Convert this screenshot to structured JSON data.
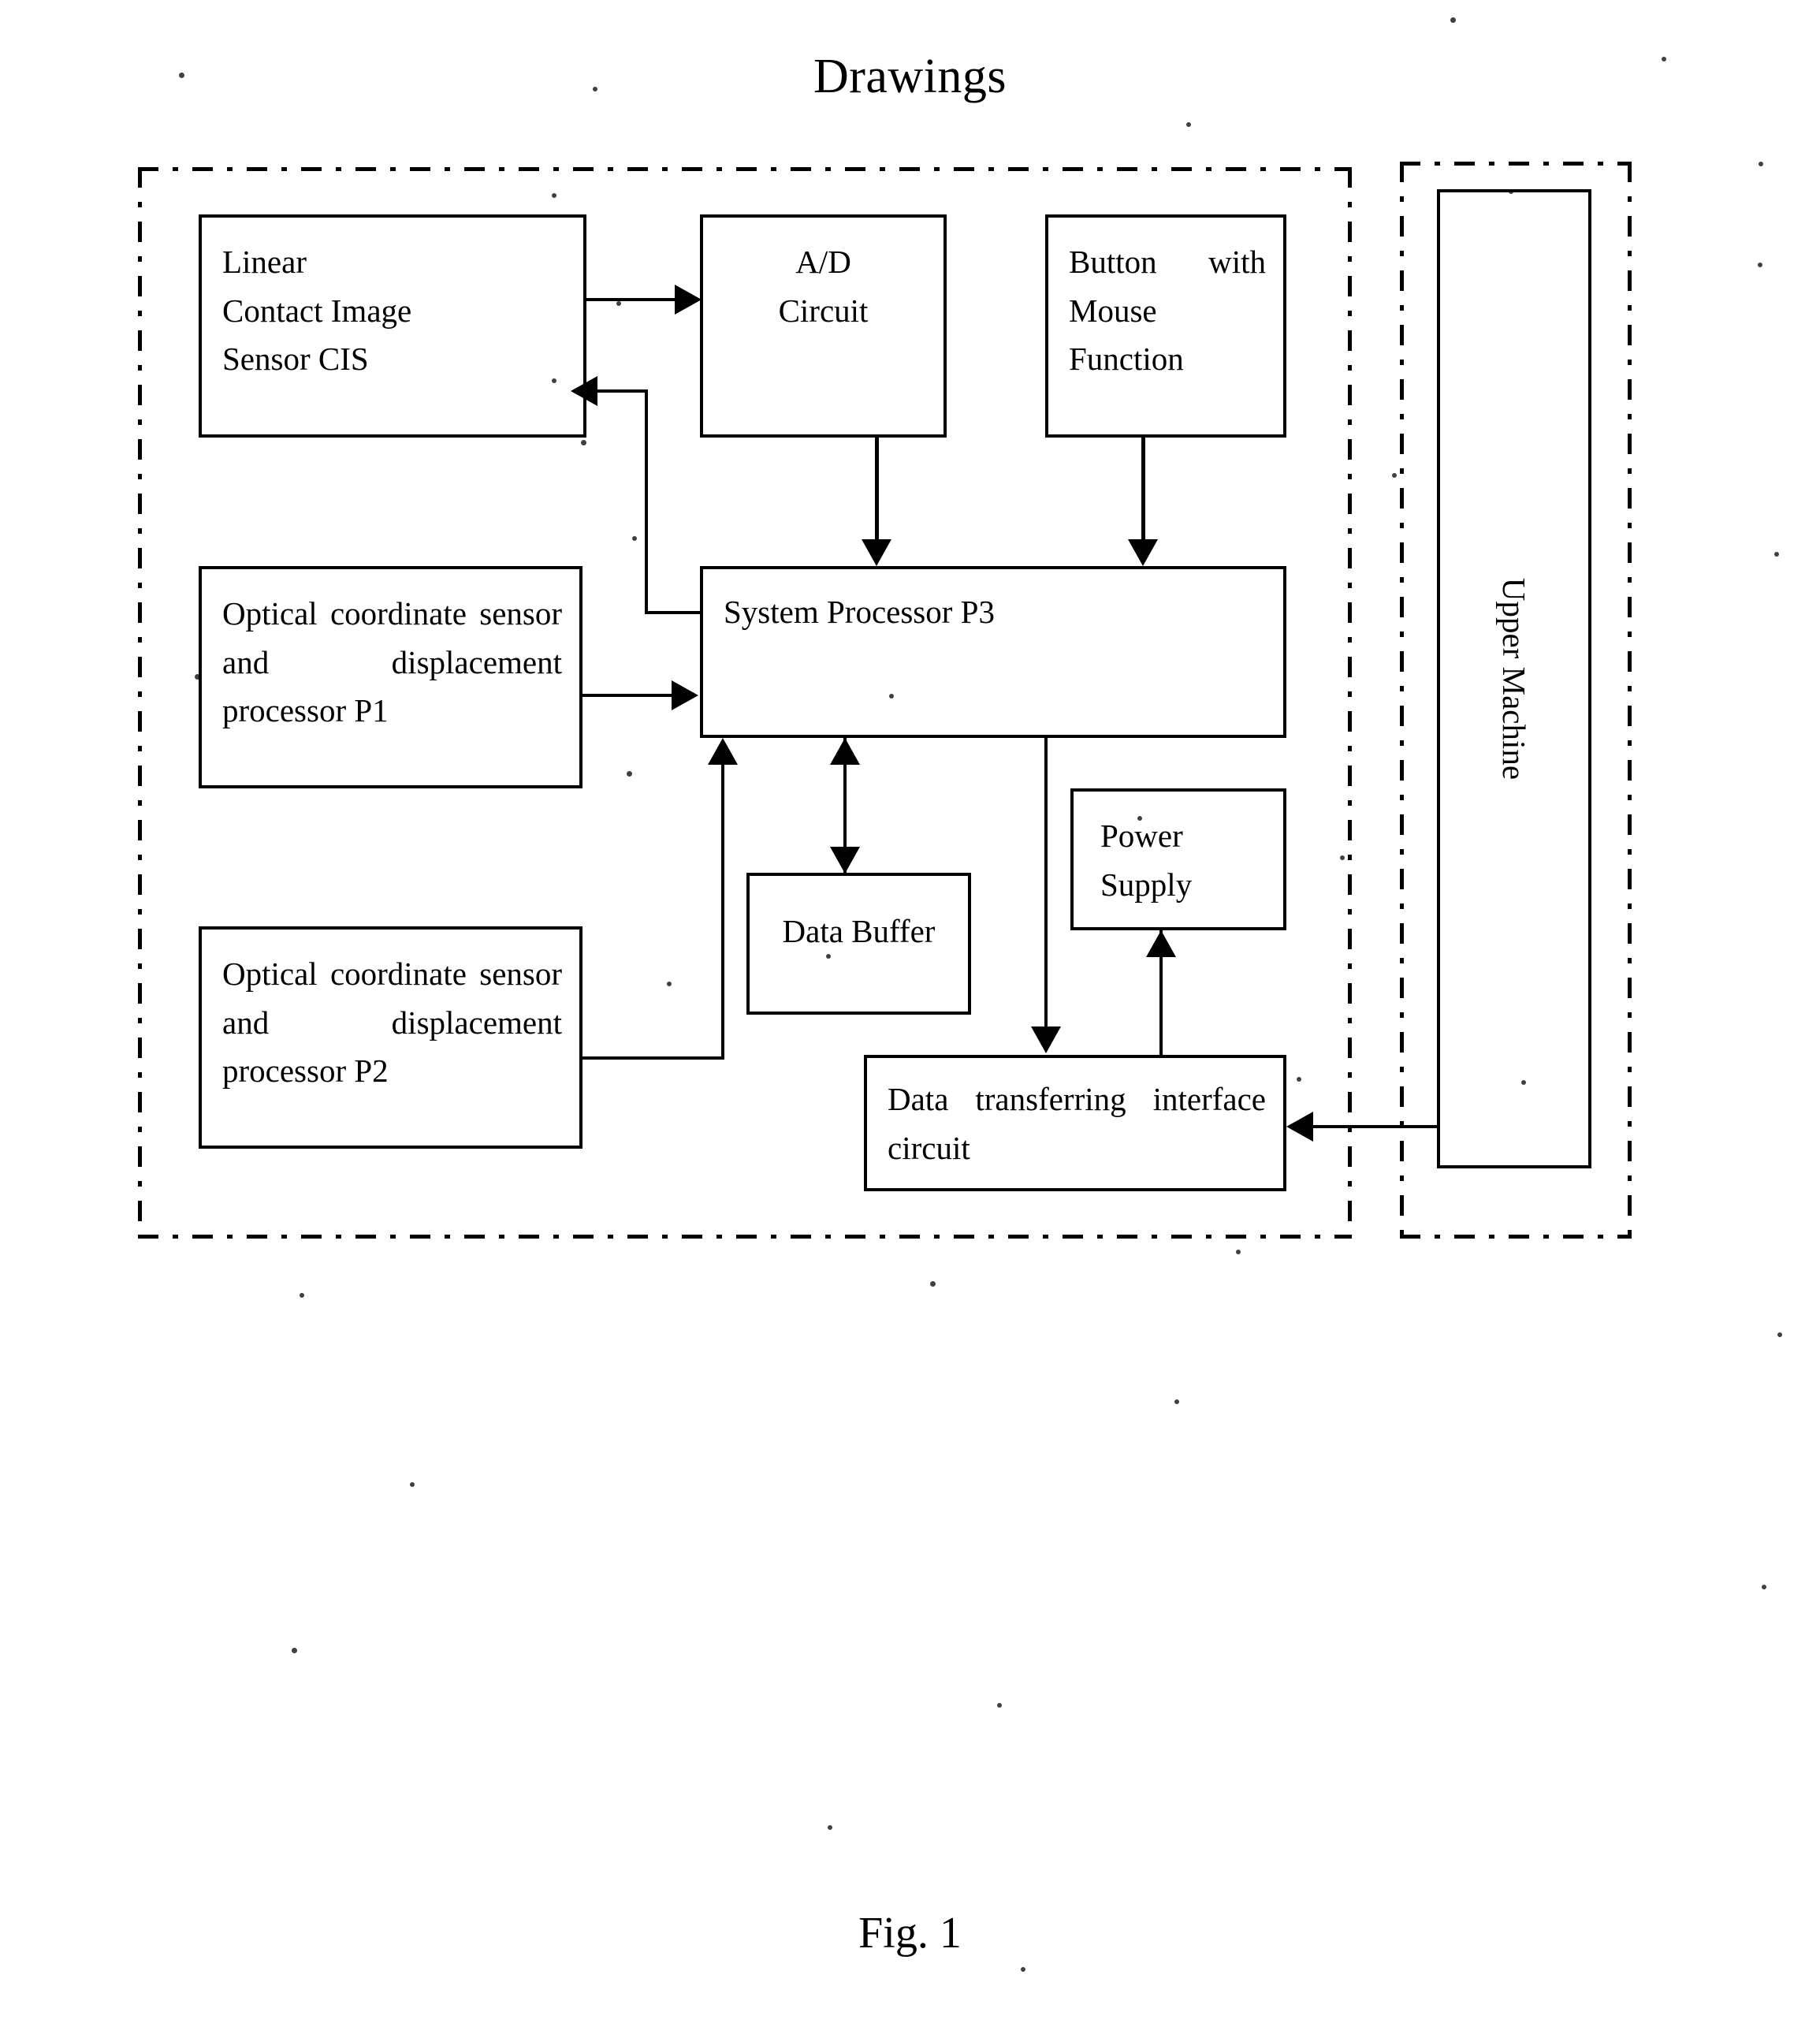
{
  "document": {
    "title": "Drawings",
    "figure_caption": "Fig. 1"
  },
  "diagram": {
    "type": "block-diagram",
    "nodes": {
      "cis": {
        "name": "Linear Contact Image Sensor CIS",
        "lines": [
          "Linear",
          "Contact Image",
          "Sensor CIS"
        ]
      },
      "ad_circuit": {
        "name": "A/D Circuit",
        "lines": [
          "A/D",
          "Circuit"
        ]
      },
      "button_mouse": {
        "name": "Button with Mouse Function",
        "line1": "Button with",
        "line2": "Mouse",
        "line3": "Function"
      },
      "sensor_p1": {
        "name": "Optical coordinate sensor and displacement processor P1",
        "text": "Optical coordinate sensor and displacement processor P1"
      },
      "sensor_p2": {
        "name": "Optical coordinate sensor and displacement processor P2",
        "text": "Optical coordinate sensor and displacement processor P2"
      },
      "system_processor": {
        "name": "System Processor P3",
        "text": "System Processor P3"
      },
      "data_buffer": {
        "name": "Data Buffer",
        "text": "Data Buffer"
      },
      "power_supply": {
        "name": "Power Supply",
        "line1": "Power",
        "line2": "Supply"
      },
      "interface_circuit": {
        "name": "Data transferring interface circuit",
        "line1": "Data transferring interface",
        "line2": "circuit"
      },
      "upper_machine": {
        "name": "Upper Machine",
        "text": "Upper Machine"
      }
    },
    "connections": [
      {
        "from": "cis",
        "to": "ad_circuit",
        "direction": "right"
      },
      {
        "from": "ad_circuit",
        "to": "system_processor",
        "direction": "down"
      },
      {
        "from": "button_mouse",
        "to": "system_processor",
        "direction": "down"
      },
      {
        "from": "system_processor",
        "to": "cis",
        "direction": "left"
      },
      {
        "from": "sensor_p1",
        "to": "system_processor",
        "direction": "right"
      },
      {
        "from": "sensor_p2",
        "to": "system_processor",
        "direction": "up"
      },
      {
        "from": "system_processor",
        "to": "data_buffer",
        "direction": "bidirectional"
      },
      {
        "from": "system_processor",
        "to": "interface_circuit",
        "direction": "down"
      },
      {
        "from": "interface_circuit",
        "to": "power_supply",
        "direction": "up"
      },
      {
        "from": "upper_machine",
        "to": "interface_circuit",
        "direction": "left"
      }
    ],
    "enclosures": [
      {
        "name": "device-boundary",
        "style": "dash-dot"
      },
      {
        "name": "upper-machine-boundary",
        "style": "dash-dot"
      }
    ]
  },
  "colors": {
    "ink": "#000000",
    "paper": "#ffffff"
  }
}
